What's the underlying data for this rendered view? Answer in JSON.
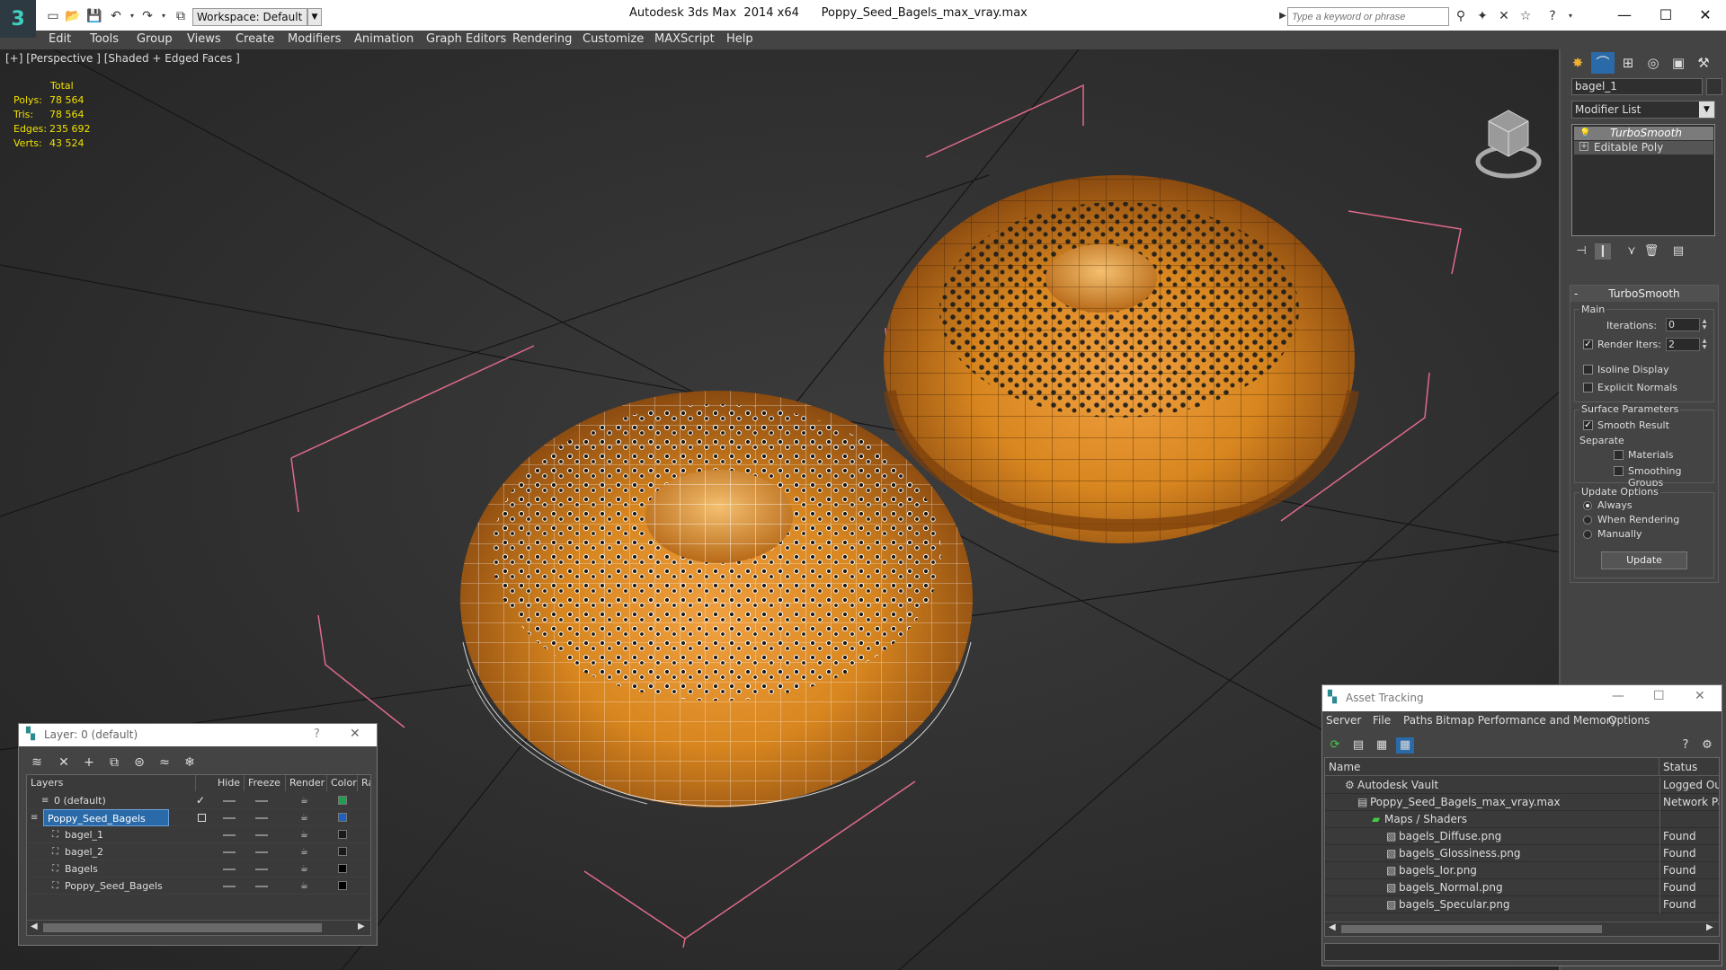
{
  "app": {
    "workspace_label": "Workspace: Default",
    "window_title": "Autodesk 3ds Max  2014 x64      Poppy_Seed_Bagels_max_vray.max",
    "search_placeholder": "Type a keyword or phrase"
  },
  "menu": [
    "Edit",
    "Tools",
    "Group",
    "Views",
    "Create",
    "Modifiers",
    "Animation",
    "Graph Editors",
    "Rendering",
    "Customize",
    "MAXScript",
    "Help"
  ],
  "viewport": {
    "label": "[+] [Perspective ] [Shaded + Edged Faces ]",
    "stats": {
      "total_label": "Total",
      "rows": [
        {
          "label": "Polys:",
          "value": "78 564"
        },
        {
          "label": "Tris:",
          "value": "78 564"
        },
        {
          "label": "Edges:",
          "value": "235 692"
        },
        {
          "label": "Verts:",
          "value": "43 524"
        }
      ]
    },
    "colors": {
      "bagel": "#d88a2a",
      "selection_wire": "#ffffff",
      "bbox": "#e06a8a",
      "grid": "#1a1a1a"
    }
  },
  "command_panel": {
    "object_name": "bagel_1",
    "modifier_list": "Modifier List",
    "stack": [
      "TurboSmooth",
      "Editable Poly"
    ],
    "turbosmooth": {
      "title": "TurboSmooth",
      "main_label": "Main",
      "iterations_label": "Iterations:",
      "iterations_value": "0",
      "render_iters_label": "Render Iters:",
      "render_iters_value": "2",
      "isoline_label": "Isoline Display",
      "explicit_label": "Explicit Normals",
      "surface_label": "Surface Parameters",
      "smooth_label": "Smooth Result",
      "separate_label": "Separate",
      "materials_label": "Materials",
      "smoothing_label": "Smoothing Groups",
      "update_options_label": "Update Options",
      "always_label": "Always",
      "when_rendering_label": "When Rendering",
      "manually_label": "Manually",
      "update_button": "Update"
    }
  },
  "layer_window": {
    "title": "Layer: 0 (default)",
    "columns": [
      "Layers",
      "Hide",
      "Freeze",
      "Render",
      "Color",
      "Ra"
    ],
    "rows": [
      {
        "name": "0 (default)",
        "color": "#1fa050"
      },
      {
        "name": "Poppy_Seed_Bagels",
        "color": "#2060c0"
      },
      {
        "name": "bagel_1",
        "color": "#1a1a1a"
      },
      {
        "name": "bagel_2",
        "color": "#1a1a1a"
      },
      {
        "name": "Bagels",
        "color": "#000000"
      },
      {
        "name": "Poppy_Seed_Bagels",
        "color": "#000000"
      }
    ]
  },
  "asset_tracking": {
    "title": "Asset Tracking",
    "menus": [
      "Server",
      "File",
      "Paths",
      "Bitmap Performance and Memory",
      "Options"
    ],
    "columns": [
      "Name",
      "Status"
    ],
    "rows": [
      {
        "name": "Autodesk Vault",
        "status": "Logged Ou"
      },
      {
        "name": "Poppy_Seed_Bagels_max_vray.max",
        "status": "Network Pa"
      },
      {
        "name": "Maps / Shaders",
        "status": ""
      },
      {
        "name": "bagels_Diffuse.png",
        "status": "Found"
      },
      {
        "name": "bagels_Glossiness.png",
        "status": "Found"
      },
      {
        "name": "bagels_Ior.png",
        "status": "Found"
      },
      {
        "name": "bagels_Normal.png",
        "status": "Found"
      },
      {
        "name": "bagels_Specular.png",
        "status": "Found"
      }
    ]
  }
}
